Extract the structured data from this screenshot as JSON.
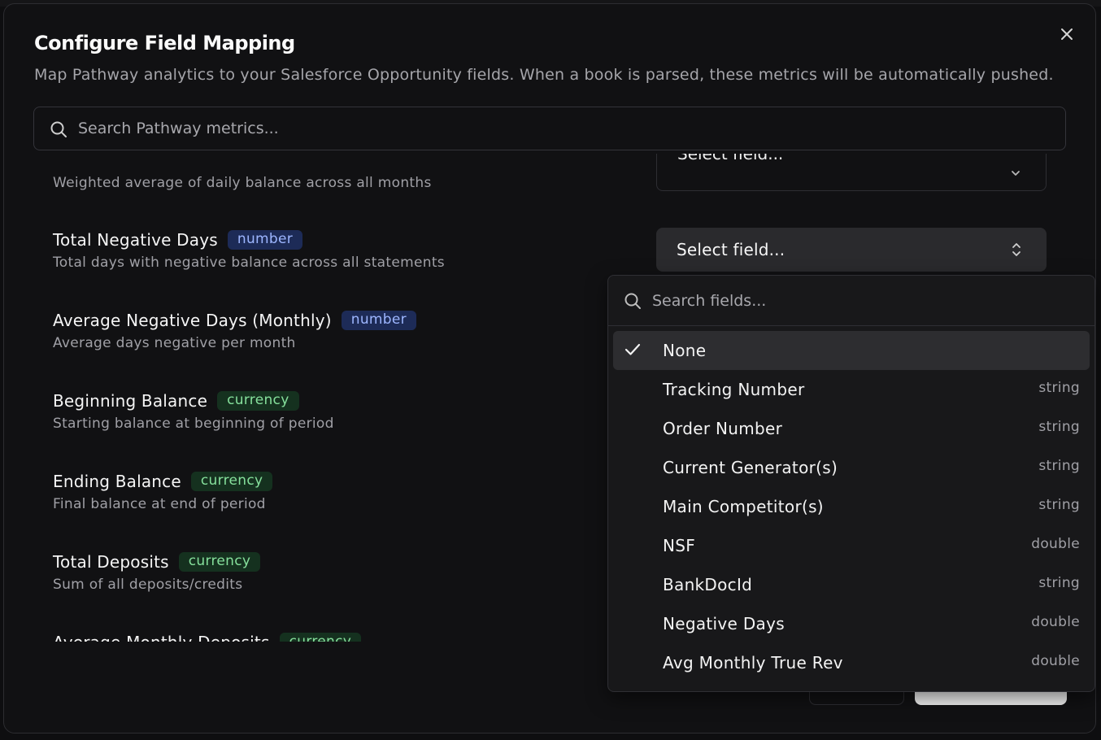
{
  "dialog": {
    "title": "Configure Field Mapping",
    "subtitle": "Map Pathway analytics to your Salesforce Opportunity fields. When a book is parsed, these metrics will be automatically pushed.",
    "close_icon": "close-icon"
  },
  "search": {
    "placeholder": "Search Pathway metrics...",
    "icon": "search-icon"
  },
  "metrics": [
    {
      "name": "",
      "type": "",
      "description": "Weighted average of daily balance across all months",
      "select_label": "Select field..."
    },
    {
      "name": "Total Negative Days",
      "type": "number",
      "description": "Total days with negative balance across all statements",
      "select_label": "Select field..."
    },
    {
      "name": "Average Negative Days (Monthly)",
      "type": "number",
      "description": "Average days negative per month"
    },
    {
      "name": "Beginning Balance",
      "type": "currency",
      "description": "Starting balance at beginning of period"
    },
    {
      "name": "Ending Balance",
      "type": "currency",
      "description": "Final balance at end of period"
    },
    {
      "name": "Total Deposits",
      "type": "currency",
      "description": "Sum of all deposits/credits"
    },
    {
      "name": "Average Monthly Deposits",
      "type": "currency",
      "description": ""
    }
  ],
  "dropdown": {
    "search_placeholder": "Search fields...",
    "options": [
      {
        "label": "None",
        "type": "",
        "selected": true
      },
      {
        "label": "Tracking Number",
        "type": "string"
      },
      {
        "label": "Order Number",
        "type": "string"
      },
      {
        "label": "Current Generator(s)",
        "type": "string"
      },
      {
        "label": "Main Competitor(s)",
        "type": "string"
      },
      {
        "label": "NSF",
        "type": "double"
      },
      {
        "label": "BankDocId",
        "type": "string"
      },
      {
        "label": "Negative Days",
        "type": "double"
      },
      {
        "label": "Avg Monthly True Rev",
        "type": "double"
      }
    ]
  },
  "colors": {
    "number_badge_bg": "#1d2b57",
    "number_badge_text": "#9db6ff",
    "currency_badge_bg": "#15311f",
    "currency_badge_text": "#86e09c"
  }
}
